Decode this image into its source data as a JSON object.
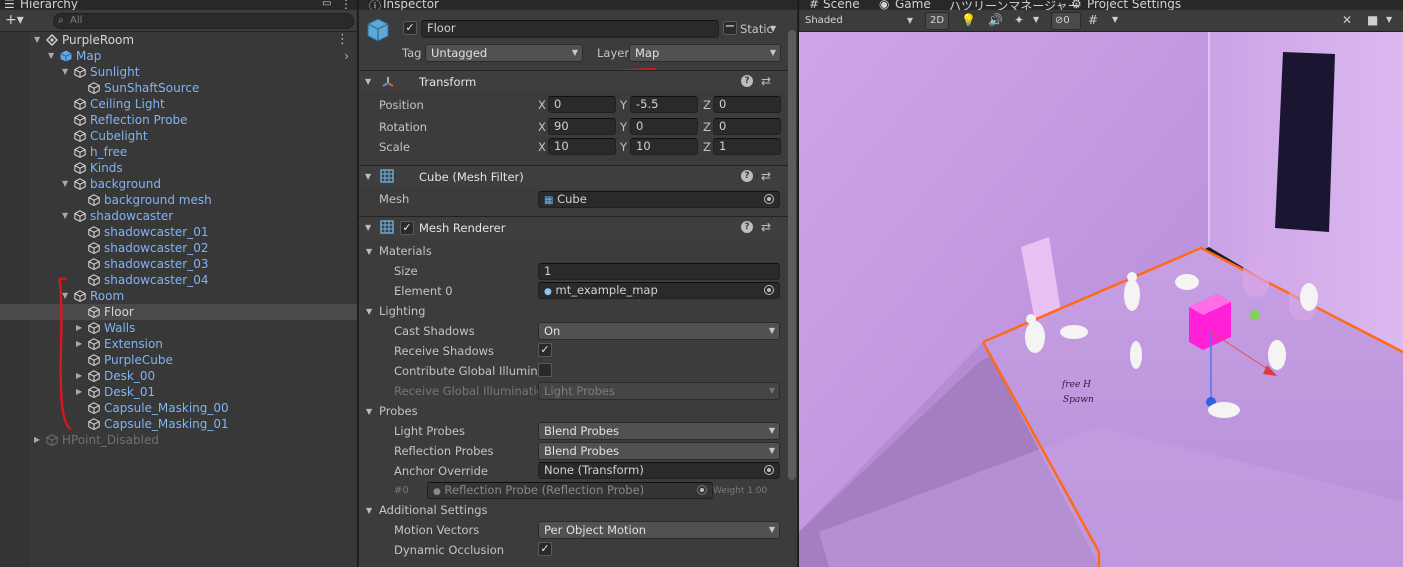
{
  "hierarchy": {
    "tab": "Hierarchy",
    "search_placeholder": "All",
    "add_symbol": "+▾",
    "items": [
      {
        "name": "PurpleRoom",
        "depth": 0,
        "arrow": "open",
        "icon": "unity-scene-icon",
        "color": "white"
      },
      {
        "name": "Map",
        "depth": 1,
        "arrow": "open",
        "icon": "prefab-cube-icon",
        "color": "blue"
      },
      {
        "name": "Sunlight",
        "depth": 2,
        "arrow": "open",
        "icon": "gameobject-cube-icon",
        "color": "blue"
      },
      {
        "name": "SunShaftSource",
        "depth": 3,
        "arrow": "none",
        "icon": "gameobject-cube-icon",
        "color": "blue"
      },
      {
        "name": "Ceiling Light",
        "depth": 2,
        "arrow": "none",
        "icon": "gameobject-cube-icon",
        "color": "blue"
      },
      {
        "name": "Reflection Probe",
        "depth": 2,
        "arrow": "none",
        "icon": "gameobject-cube-icon",
        "color": "blue"
      },
      {
        "name": "Cubelight",
        "depth": 2,
        "arrow": "none",
        "icon": "gameobject-cube-icon",
        "color": "blue"
      },
      {
        "name": "h_free",
        "depth": 2,
        "arrow": "none",
        "icon": "gameobject-cube-icon",
        "color": "blue"
      },
      {
        "name": "Kinds",
        "depth": 2,
        "arrow": "none",
        "icon": "gameobject-cube-icon",
        "color": "blue"
      },
      {
        "name": "background",
        "depth": 2,
        "arrow": "open",
        "icon": "gameobject-cube-icon",
        "color": "blue"
      },
      {
        "name": "background mesh",
        "depth": 3,
        "arrow": "none",
        "icon": "gameobject-cube-icon",
        "color": "blue"
      },
      {
        "name": "shadowcaster",
        "depth": 2,
        "arrow": "open",
        "icon": "gameobject-cube-icon",
        "color": "blue"
      },
      {
        "name": "shadowcaster_01",
        "depth": 3,
        "arrow": "none",
        "icon": "gameobject-cube-icon",
        "color": "blue"
      },
      {
        "name": "shadowcaster_02",
        "depth": 3,
        "arrow": "none",
        "icon": "gameobject-cube-icon",
        "color": "blue"
      },
      {
        "name": "shadowcaster_03",
        "depth": 3,
        "arrow": "none",
        "icon": "gameobject-cube-icon",
        "color": "blue"
      },
      {
        "name": "shadowcaster_04",
        "depth": 3,
        "arrow": "none",
        "icon": "gameobject-cube-icon",
        "color": "blue"
      },
      {
        "name": "Room",
        "depth": 2,
        "arrow": "open",
        "icon": "gameobject-cube-icon",
        "color": "blue"
      },
      {
        "name": "Floor",
        "depth": 3,
        "arrow": "none",
        "icon": "gameobject-cube-icon",
        "color": "white",
        "selected": true
      },
      {
        "name": "Walls",
        "depth": 3,
        "arrow": "closed",
        "icon": "gameobject-cube-icon",
        "color": "blue"
      },
      {
        "name": "Extension",
        "depth": 3,
        "arrow": "closed",
        "icon": "gameobject-cube-icon",
        "color": "blue"
      },
      {
        "name": "PurpleCube",
        "depth": 3,
        "arrow": "none",
        "icon": "gameobject-cube-icon",
        "color": "blue"
      },
      {
        "name": "Desk_00",
        "depth": 3,
        "arrow": "closed",
        "icon": "gameobject-cube-icon",
        "color": "blue"
      },
      {
        "name": "Desk_01",
        "depth": 3,
        "arrow": "closed",
        "icon": "gameobject-cube-icon",
        "color": "blue"
      },
      {
        "name": "Capsule_Masking_00",
        "depth": 3,
        "arrow": "none",
        "icon": "gameobject-cube-icon",
        "color": "blue"
      },
      {
        "name": "Capsule_Masking_01",
        "depth": 3,
        "arrow": "none",
        "icon": "gameobject-cube-icon",
        "color": "blue"
      },
      {
        "name": "HPoint_Disabled",
        "depth": 0,
        "arrow": "closed",
        "icon": "gameobject-cube-icon",
        "color": "grey"
      }
    ]
  },
  "inspector": {
    "tab": "Inspector",
    "object_name": "Floor",
    "static_label": "Static",
    "tag_label": "Tag",
    "tag_value": "Untagged",
    "layer_label": "Layer",
    "layer_value": "Map",
    "transform": {
      "title": "Transform",
      "rows": [
        {
          "label": "Position",
          "x": "0",
          "y": "-5.5",
          "z": "0"
        },
        {
          "label": "Rotation",
          "x": "90",
          "y": "0",
          "z": "0"
        },
        {
          "label": "Scale",
          "x": "10",
          "y": "10",
          "z": "1"
        }
      ],
      "axis_x": "X",
      "axis_y": "Y",
      "axis_z": "Z"
    },
    "mesh_filter": {
      "title": "Cube (Mesh Filter)",
      "mesh_label": "Mesh",
      "mesh_value": "Cube"
    },
    "mesh_renderer": {
      "title": "Mesh Renderer",
      "materials_label": "Materials",
      "size_label": "Size",
      "size_value": "1",
      "element0_label": "Element 0",
      "element0_value": "mt_example_map",
      "lighting_label": "Lighting",
      "cast_shadows_label": "Cast Shadows",
      "cast_shadows_value": "On",
      "receive_shadows_label": "Receive Shadows",
      "contribute_gi_label": "Contribute Global Illuminat",
      "receive_gi_label": "Receive Global Illumination",
      "receive_gi_value": "Light Probes",
      "probes_label": "Probes",
      "light_probes_label": "Light Probes",
      "light_probes_value": "Blend Probes",
      "reflection_probes_label": "Reflection Probes",
      "reflection_probes_value": "Blend Probes",
      "anchor_override_label": "Anchor Override",
      "anchor_override_value": "None (Transform)",
      "probe_index": "#0",
      "probe_entry": "Reflection Probe (Reflection Probe)",
      "probe_weight": "Weight 1.00",
      "additional_label": "Additional Settings",
      "motion_vectors_label": "Motion Vectors",
      "motion_vectors_value": "Per Object Motion",
      "dynamic_occlusion_label": "Dynamic Occlusion"
    }
  },
  "scene": {
    "tabs": [
      "Scene",
      "Game",
      "ハツリーンマネージャー",
      "Project Settings"
    ],
    "shading_mode": "Shaded",
    "mode_2d": "2D",
    "hidden_count": "0",
    "annotation_text_1": "free H",
    "annotation_text_2": "Spawn"
  },
  "colors": {
    "hier_blue": "#7fb3f5",
    "selection_orange": "#ff6a1a",
    "room_purple": "#c9a6e6",
    "cube_magenta": "#ff20d8",
    "red_annotation": "#d8161b"
  }
}
